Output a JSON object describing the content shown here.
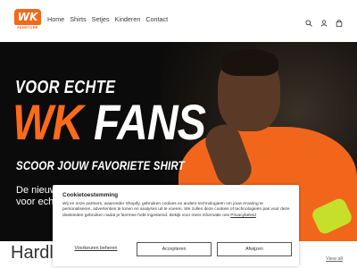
{
  "brand": {
    "logo_text": "WK",
    "logo_subtext": "FANSTORE",
    "accent_color": "#f06a1a"
  },
  "nav": {
    "items": [
      {
        "label": "Home"
      },
      {
        "label": "Shirts"
      },
      {
        "label": "Setjes"
      },
      {
        "label": "Kinderen"
      },
      {
        "label": "Contact"
      }
    ]
  },
  "header_icons": [
    "search-icon",
    "user-icon",
    "cart-icon"
  ],
  "hero": {
    "line1": "VOOR ECHTE",
    "line2_accent": "WK",
    "line2_white": "FANS",
    "line3": "SCOOR JOUW FAVORIETE SHIRT",
    "small_line1": "De nieuws",
    "small_line2": "voor echt"
  },
  "section": {
    "title": "Hardlop",
    "view_all": "View all"
  },
  "cookie": {
    "title": "Cookietoestemming",
    "text": "Wij en onze partners, waaronder Shopify, gebruiken cookies en andere technologieën om jouw ervaring te personaliseren, advertenties te tonen en analyses uit te voeren. We zullen deze cookies of technologieën pas voor deze doeleinden gebruiken nadat je hiermee hebt ingestemd. Bekijk voor meer informatie ons",
    "link": "Privacybeleid",
    "prefs_button": "Voorkeuren beheren",
    "accept_button": "Accepteren",
    "decline_button": "Afwijzen"
  }
}
